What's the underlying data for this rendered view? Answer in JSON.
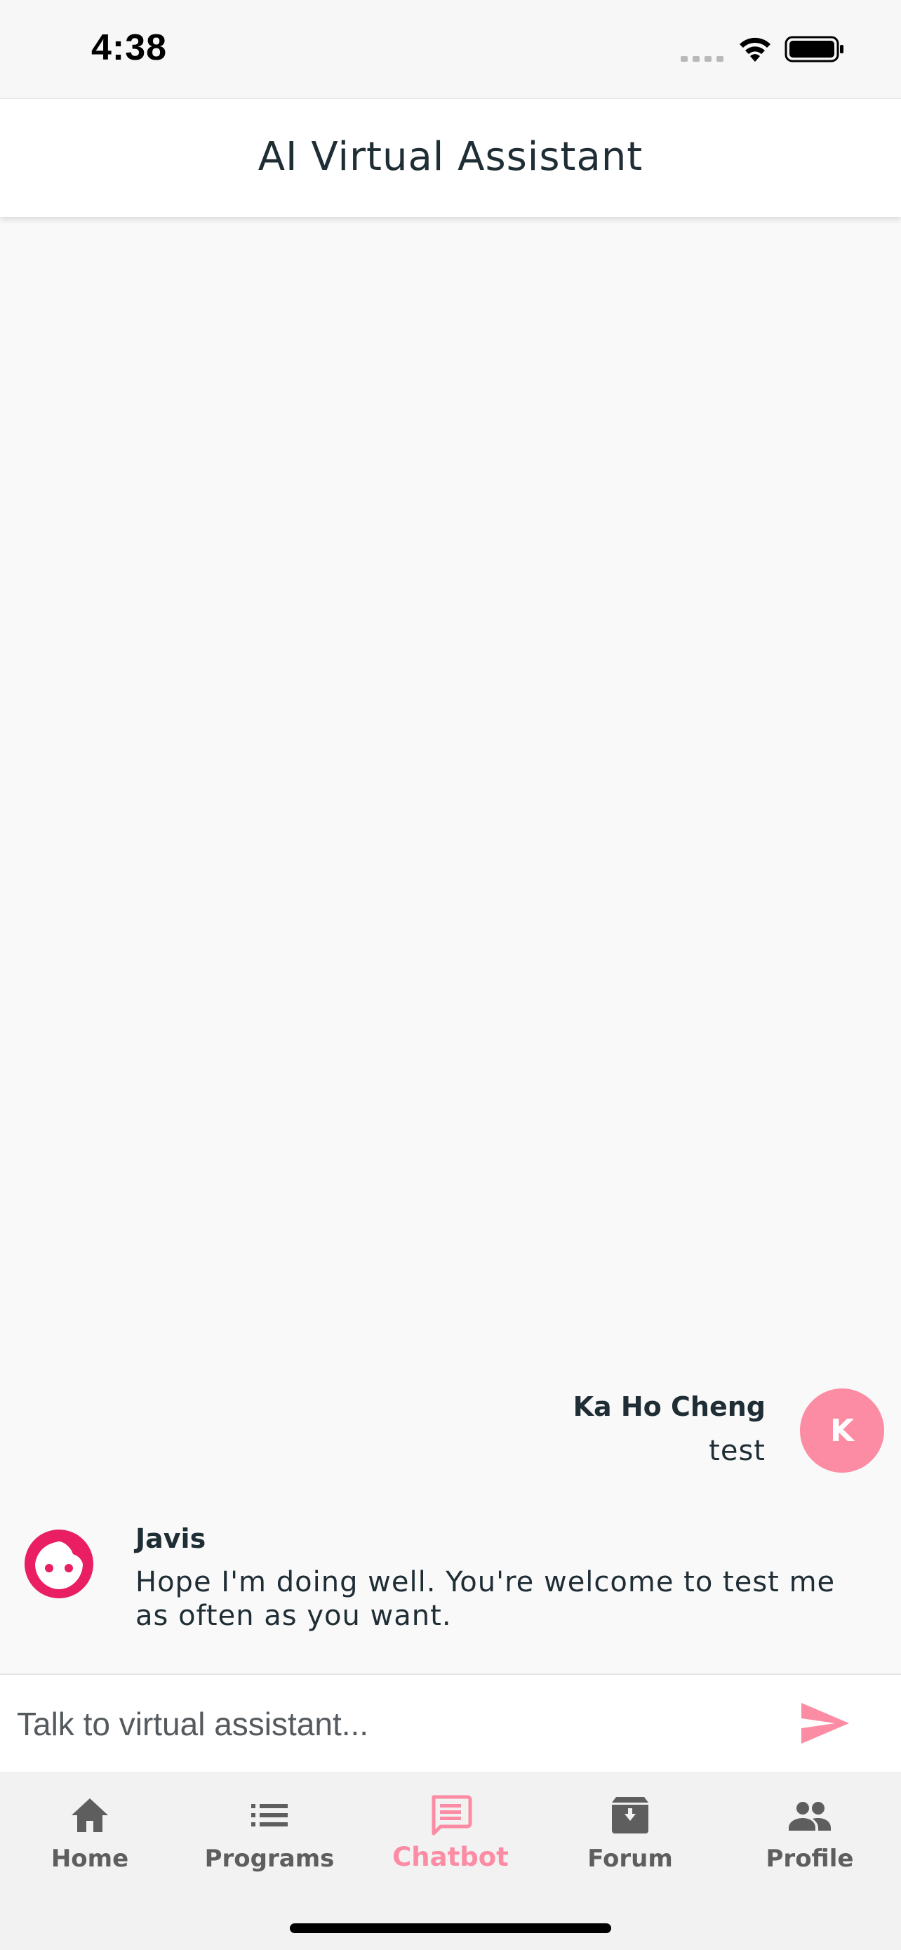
{
  "status_bar": {
    "time": "4:38"
  },
  "header": {
    "title": "AI Virtual Assistant"
  },
  "messages": [
    {
      "sender": "Ka Ho Cheng",
      "text": "test",
      "avatar_initial": "K",
      "side": "right",
      "avatar_color": "#fc8ca3"
    },
    {
      "sender": "Javis",
      "text": "Hope I'm doing well. You're welcome to test me as often as you want.",
      "side": "left",
      "avatar_icon": "bot-face-icon",
      "avatar_color": "#e91e63"
    }
  ],
  "input": {
    "placeholder": "Talk to virtual assistant...",
    "value": "",
    "send_icon": "send-icon"
  },
  "tabs": [
    {
      "label": "Home",
      "icon": "home-icon",
      "active": false
    },
    {
      "label": "Programs",
      "icon": "list-icon",
      "active": false
    },
    {
      "label": "Chatbot",
      "icon": "chat-icon",
      "active": true
    },
    {
      "label": "Forum",
      "icon": "archive-icon",
      "active": false
    },
    {
      "label": "Profile",
      "icon": "people-icon",
      "active": false
    }
  ],
  "colors": {
    "accent": "#fc8ca3",
    "bot_avatar": "#e91e63",
    "text": "#1f2d35",
    "inactive_tab": "#5e5e5e"
  }
}
